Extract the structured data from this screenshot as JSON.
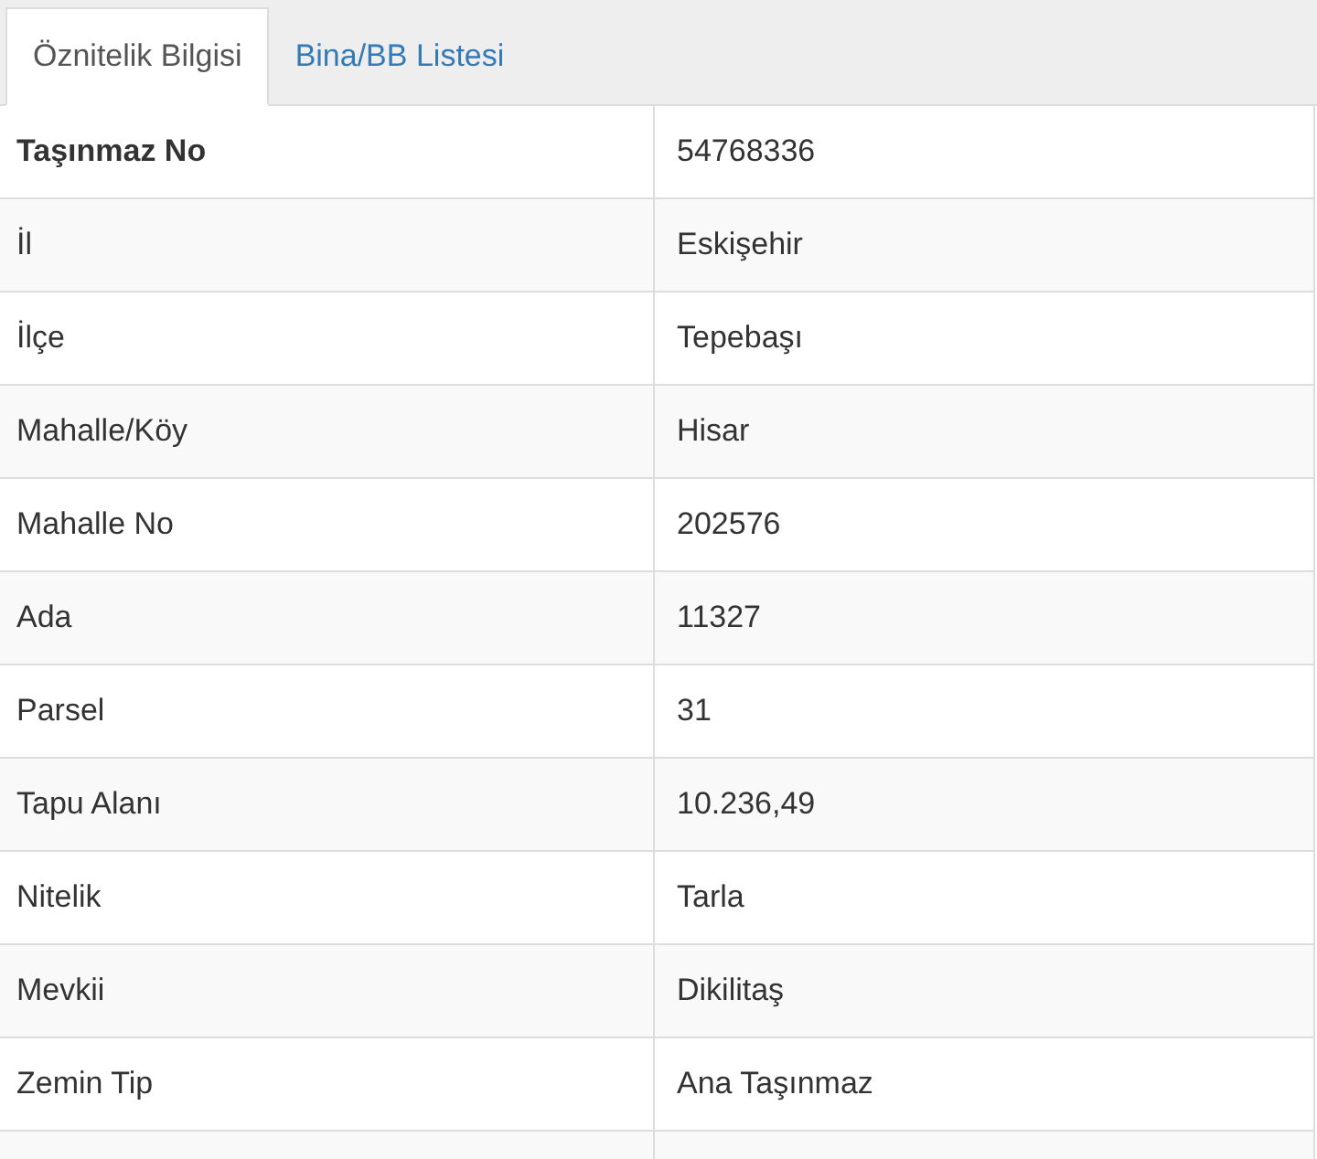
{
  "tabs": [
    {
      "label": "Öznitelik Bilgisi",
      "selected": true
    },
    {
      "label": "Bina/BB Listesi",
      "selected": false
    }
  ],
  "table": {
    "rows": [
      {
        "kind": "header",
        "label": "Taşınmaz No",
        "value": "54768336"
      },
      {
        "kind": "field",
        "label": "İl",
        "value": "Eskişehir"
      },
      {
        "kind": "field",
        "label": "İlçe",
        "value": "Tepebaşı"
      },
      {
        "kind": "field",
        "label": "Mahalle/Köy",
        "value": "Hisar"
      },
      {
        "kind": "field",
        "label": "Mahalle No",
        "value": "202576"
      },
      {
        "kind": "field",
        "label": "Ada",
        "value": "11327"
      },
      {
        "kind": "field",
        "label": "Parsel",
        "value": "31"
      },
      {
        "kind": "field",
        "label": "Tapu Alanı",
        "value": "10.236,49"
      },
      {
        "kind": "field",
        "label": "Nitelik",
        "value": "Tarla"
      },
      {
        "kind": "field",
        "label": "Mevkii",
        "value": "Dikilitaş"
      },
      {
        "kind": "field",
        "label": "Zemin Tip",
        "value": "Ana Taşınmaz"
      }
    ]
  }
}
